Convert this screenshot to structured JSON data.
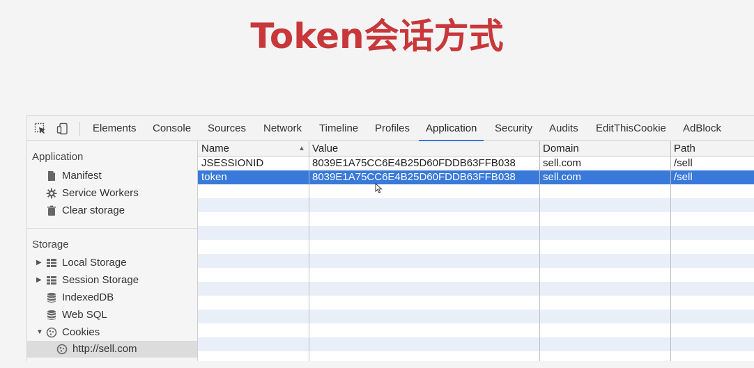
{
  "slide": {
    "title": "Token会话方式"
  },
  "toolbar": {
    "tabs": [
      {
        "label": "Elements"
      },
      {
        "label": "Console"
      },
      {
        "label": "Sources"
      },
      {
        "label": "Network"
      },
      {
        "label": "Timeline"
      },
      {
        "label": "Profiles"
      },
      {
        "label": "Application",
        "active": true
      },
      {
        "label": "Security"
      },
      {
        "label": "Audits"
      },
      {
        "label": "EditThisCookie"
      },
      {
        "label": "AdBlock"
      }
    ],
    "icons": [
      "inspect-element-icon",
      "device-mode-icon"
    ]
  },
  "sidebar": {
    "application_header": "Application",
    "application_items": [
      {
        "label": "Manifest",
        "icon": "document-icon"
      },
      {
        "label": "Service Workers",
        "icon": "gear-icon"
      },
      {
        "label": "Clear storage",
        "icon": "trash-icon"
      }
    ],
    "storage_header": "Storage",
    "storage_items": [
      {
        "label": "Local Storage",
        "icon": "grid-icon",
        "expandable": true,
        "expanded": false
      },
      {
        "label": "Session Storage",
        "icon": "grid-icon",
        "expandable": true,
        "expanded": false
      },
      {
        "label": "IndexedDB",
        "icon": "database-icon"
      },
      {
        "label": "Web SQL",
        "icon": "database-icon"
      },
      {
        "label": "Cookies",
        "icon": "cookie-icon",
        "expandable": true,
        "expanded": true
      }
    ],
    "cookie_sites": [
      {
        "label": "http://sell.com",
        "icon": "cookie-icon",
        "selected": true
      }
    ]
  },
  "table": {
    "columns": [
      "Name",
      "Value",
      "Domain",
      "Path"
    ],
    "sort_column": "Name",
    "sort_direction": "ascending",
    "rows": [
      {
        "name": "JSESSIONID",
        "value": "8039E1A75CC6E4B25D60FDDB63FFB038",
        "domain": "sell.com",
        "path": "/sell"
      },
      {
        "name": "token",
        "value": "8039E1A75CC6E4B25D60FDDB63FFB038",
        "domain": "sell.com",
        "path": "/sell",
        "selected": true
      }
    ]
  },
  "colors": {
    "title": "#c8373a",
    "selection": "#3879d9",
    "stripe": "#e9eff9"
  }
}
